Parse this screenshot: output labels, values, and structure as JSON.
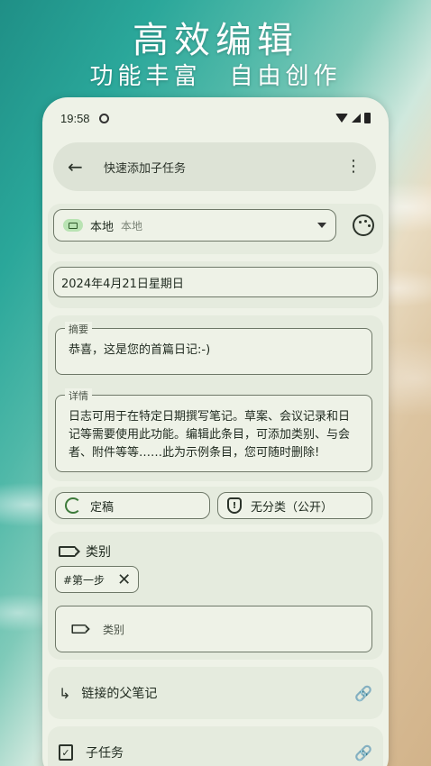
{
  "promo": {
    "headline": "高效编辑",
    "subline": "功能丰富　自由创作"
  },
  "status_bar": {
    "time": "19:58"
  },
  "toolbar": {
    "title": "快速添加子任务",
    "back_glyph": "←",
    "menu_glyph": "⋮"
  },
  "collection": {
    "name": "本地",
    "account": "本地"
  },
  "date": {
    "value": "2024年4月21日星期日"
  },
  "summary": {
    "label": "摘要",
    "value": "恭喜，这是您的首篇日记:-)"
  },
  "details": {
    "label": "详情",
    "value": "日志可用于在特定日期撰写笔记。草案、会议记录和日记等需要使用此功能。编辑此条目，可添加类别、与会者、附件等等……此为示例条目，您可随时删除!"
  },
  "status": {
    "state_label": "定稿",
    "classification_label": "无分类（公开）",
    "shield_glyph": "!"
  },
  "categories": {
    "header": "类别",
    "chips": [
      {
        "label": "#第一步"
      }
    ],
    "input_placeholder": "类别",
    "chip_remove_glyph": "✕"
  },
  "parent": {
    "label": "链接的父笔记",
    "arrow_glyph": "↳",
    "link_glyph": "🔗"
  },
  "subtasks": {
    "label": "子任务",
    "check_glyph": "✓",
    "link_glyph": "🔗"
  },
  "colors": {
    "surface": "#eef2e7",
    "card": "#e5ebde",
    "accent": "#3d7a3a",
    "chip_green": "#b9e3b3"
  },
  "icons": [
    "back-arrow-icon",
    "more-vert-icon",
    "folder-icon",
    "dropdown-icon",
    "palette-icon",
    "sync-icon",
    "shield-icon",
    "label-icon",
    "close-icon",
    "subdirectory-arrow-icon",
    "add-link-icon",
    "checkbox-icon",
    "wifi-icon",
    "signal-icon",
    "battery-icon"
  ]
}
